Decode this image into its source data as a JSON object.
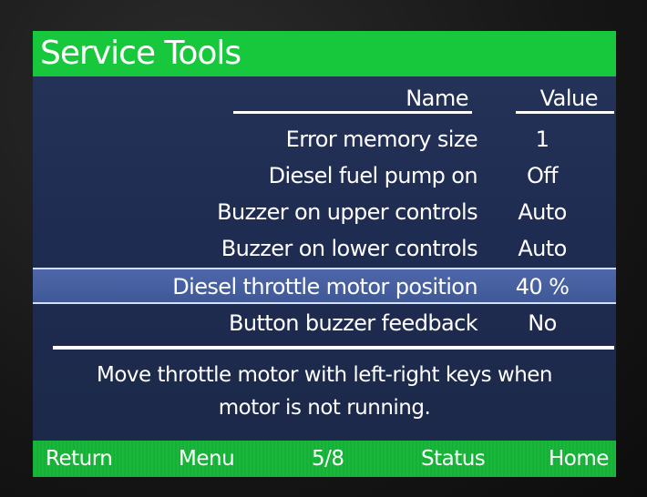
{
  "title": "Service Tools",
  "columns": {
    "name": "Name",
    "value": "Value"
  },
  "rows": [
    {
      "name": "Error memory size",
      "value": "1"
    },
    {
      "name": "Diesel fuel pump on",
      "value": "Off"
    },
    {
      "name": "Buzzer on upper controls",
      "value": "Auto"
    },
    {
      "name": "Buzzer on lower controls",
      "value": "Auto"
    },
    {
      "name": "Diesel throttle motor position",
      "value": "40 %"
    },
    {
      "name": "Button buzzer feedback",
      "value": "No"
    }
  ],
  "selected_row": 4,
  "help_text": {
    "line1": "Move throttle motor with left-right keys when",
    "line2": "motor is not running."
  },
  "footer": {
    "return": "Return",
    "menu": "Menu",
    "page": "5/8",
    "status": "Status",
    "home": "Home"
  },
  "colors": {
    "title_bar": "#18c83c",
    "footer_bar": "#18b83a",
    "screen_background": "#22305a",
    "selected_row": "#4a62a2",
    "text": "#ffffff"
  }
}
